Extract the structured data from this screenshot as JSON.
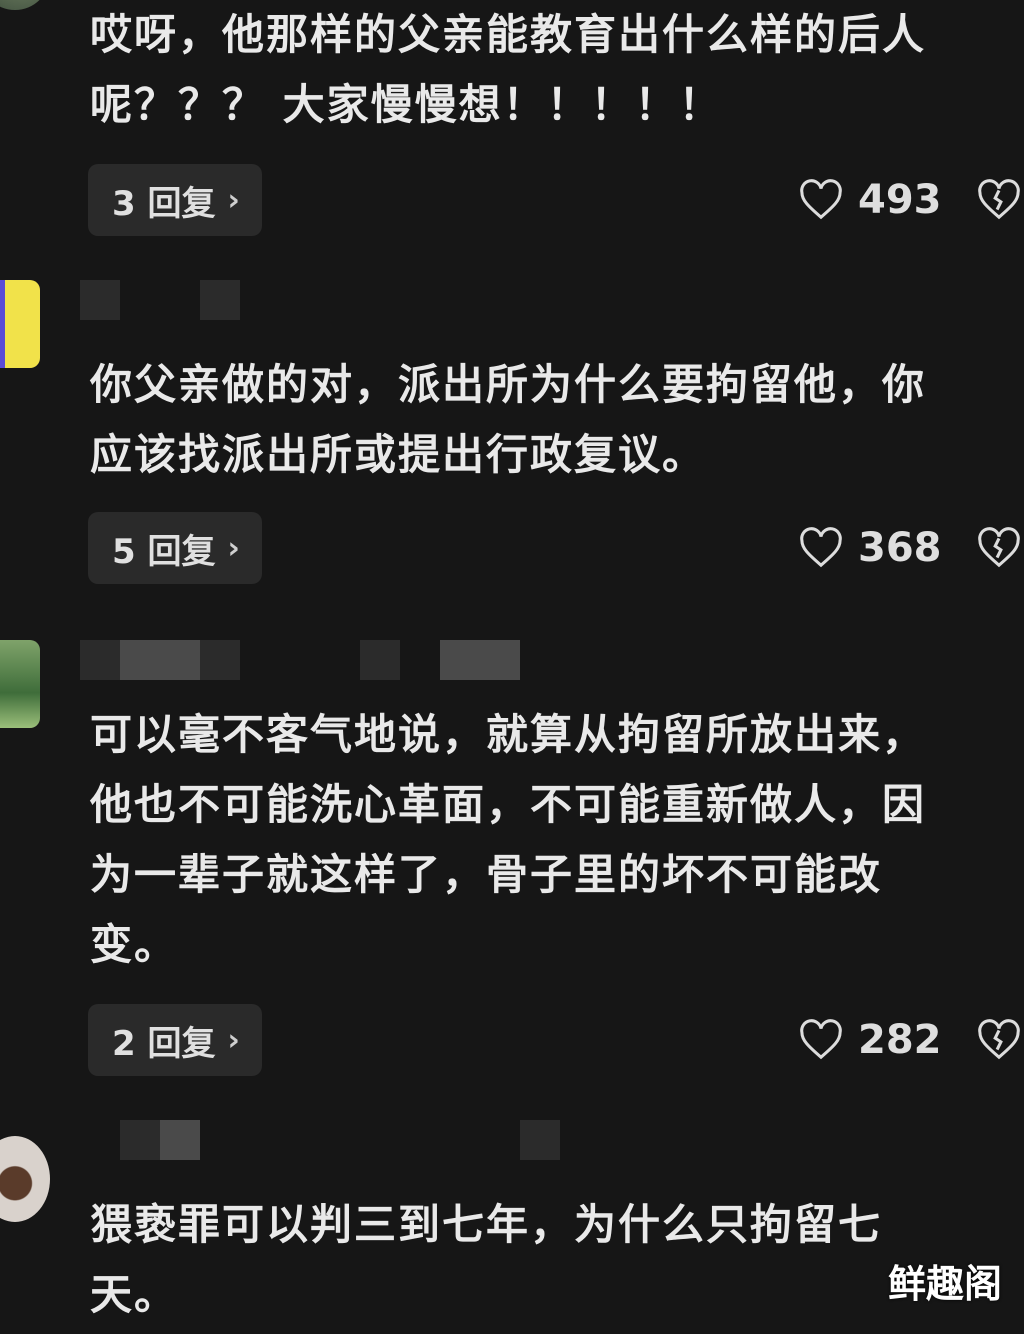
{
  "comments": [
    {
      "text_lines": [
        "哎呀，他那样的父亲能教育出什么样的后人",
        "呢？？？ 大家慢慢想！！！！！"
      ],
      "reply_label": "3 回复",
      "likes": "493"
    },
    {
      "text_lines": [
        "你父亲做的对，派出所为什么要拘留他，你",
        "应该找派出所或提出行政复议。"
      ],
      "reply_label": "5 回复",
      "likes": "368"
    },
    {
      "text_lines": [
        "可以毫不客气地说，就算从拘留所放出来，",
        "他也不可能洗心革面，不可能重新做人，因",
        "为一辈子就这样了，骨子里的坏不可能改",
        "变。"
      ],
      "reply_label": "2 回复",
      "likes": "282"
    },
    {
      "text_lines": [
        "猥亵罪可以判三到七年，为什么只拘留七",
        "天。"
      ]
    }
  ],
  "icons": {
    "like": "heart-outline-icon",
    "dislike": "broken-heart-icon",
    "reply_chevron": "chevron-right-icon"
  },
  "watermark": "鲜趣阁"
}
